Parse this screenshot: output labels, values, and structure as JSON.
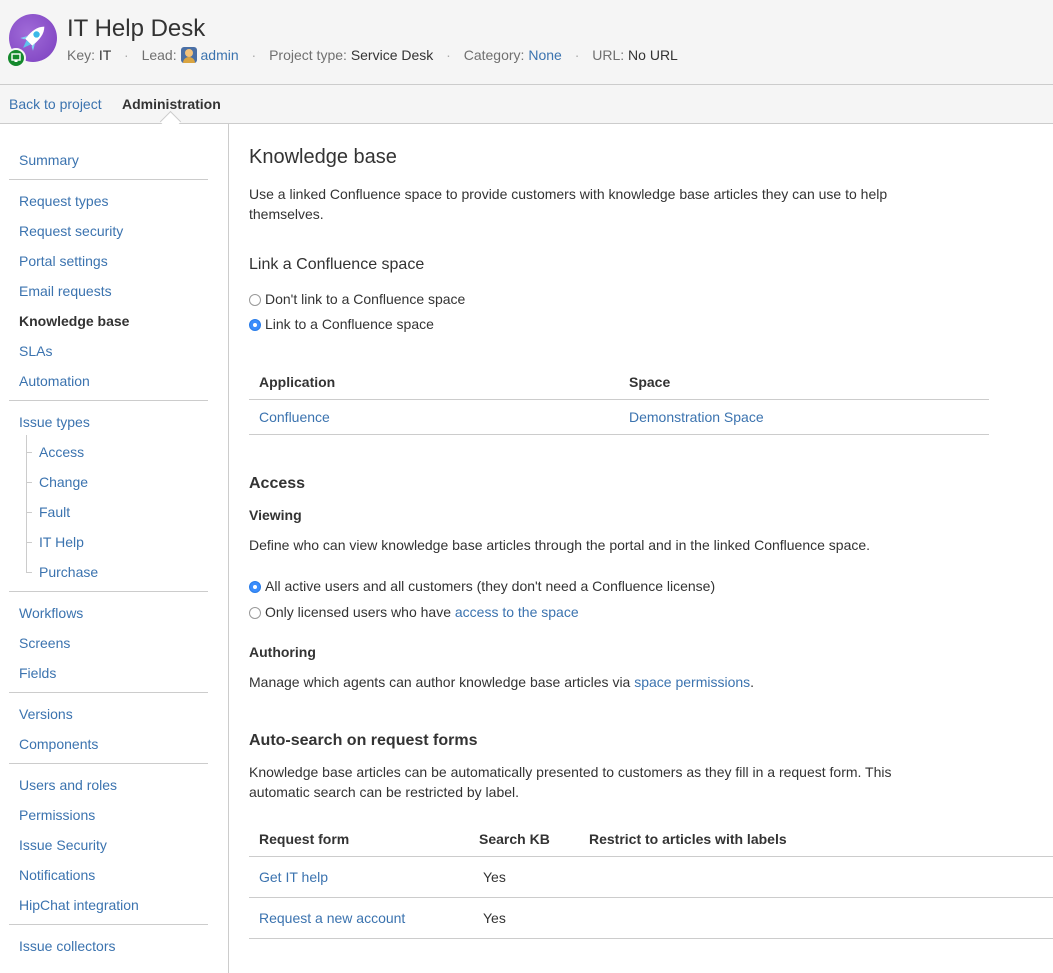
{
  "header": {
    "title": "IT Help Desk",
    "key_label": "Key:",
    "key_value": "IT",
    "lead_label": "Lead:",
    "lead_value": "admin",
    "type_label": "Project type:",
    "type_value": "Service Desk",
    "category_label": "Category:",
    "category_value": "None",
    "url_label": "URL:",
    "url_value": "No URL",
    "separator": "·",
    "avatar_icon": "rocket-icon",
    "badge_icon": "service-desk-icon"
  },
  "nav": {
    "back_label": "Back to project",
    "admin_label": "Administration"
  },
  "sidebar": {
    "items": [
      {
        "label": "Summary"
      },
      {
        "label": "Request types"
      },
      {
        "label": "Request security"
      },
      {
        "label": "Portal settings"
      },
      {
        "label": "Email requests"
      },
      {
        "label": "Knowledge base",
        "active": true
      },
      {
        "label": "SLAs"
      },
      {
        "label": "Automation"
      },
      {
        "label": "Issue types"
      },
      {
        "label": "Access"
      },
      {
        "label": "Change"
      },
      {
        "label": "Fault"
      },
      {
        "label": "IT Help"
      },
      {
        "label": "Purchase"
      },
      {
        "label": "Workflows"
      },
      {
        "label": "Screens"
      },
      {
        "label": "Fields"
      },
      {
        "label": "Versions"
      },
      {
        "label": "Components"
      },
      {
        "label": "Users and roles"
      },
      {
        "label": "Permissions"
      },
      {
        "label": "Issue Security"
      },
      {
        "label": "Notifications"
      },
      {
        "label": "HipChat integration"
      },
      {
        "label": "Issue collectors"
      }
    ]
  },
  "main": {
    "title": "Knowledge base",
    "intro": "Use a linked Confluence space to provide customers with knowledge base articles they can use to help themselves.",
    "link_section": {
      "heading": "Link a Confluence space",
      "options": [
        {
          "label": "Don't link to a Confluence space",
          "checked": false
        },
        {
          "label": "Link to a Confluence space",
          "checked": true
        }
      ],
      "table": {
        "headers": [
          "Application",
          "Space"
        ],
        "rows": [
          [
            "Confluence",
            "Demonstration Space"
          ]
        ]
      }
    },
    "access": {
      "heading": "Access",
      "viewing_heading": "Viewing",
      "viewing_desc": "Define who can view knowledge base articles through the portal and in the linked Confluence space.",
      "option_all": "All active users and all customers (they don't need a Confluence license)",
      "option_licensed_prefix": "Only licensed users who have ",
      "option_licensed_link": "access to the space",
      "authoring_heading": "Authoring",
      "authoring_prefix": "Manage which agents can author knowledge base articles via ",
      "authoring_link": "space permissions",
      "authoring_suffix": "."
    },
    "autosearch": {
      "heading": "Auto-search on request forms",
      "desc": "Knowledge base articles can be automatically presented to customers as they fill in a request form. This automatic search can be restricted by label.",
      "headers": [
        "Request form",
        "Search KB",
        "Restrict to articles with labels"
      ],
      "rows": [
        [
          "Get IT help",
          "Yes",
          ""
        ],
        [
          "Request a new account",
          "Yes",
          ""
        ]
      ]
    }
  },
  "colors": {
    "link": "#3b73af",
    "text": "#333333",
    "header_bg": "#f5f5f5",
    "border": "#cccccc",
    "radio_on": "#3b8dfc",
    "avatar": "#8a4fcf",
    "badge": "#14892c"
  }
}
